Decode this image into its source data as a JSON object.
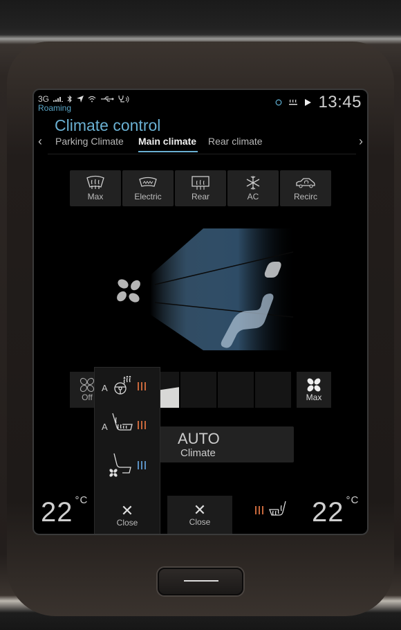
{
  "status_bar": {
    "network": "3G",
    "roaming": "Roaming",
    "left_icons": [
      "signal-icon",
      "bluetooth-icon",
      "location-icon",
      "wifi-icon",
      "usb-icon",
      "stethoscope-icon"
    ],
    "right_icons": [
      "sync-icon",
      "heat-icon",
      "play-icon"
    ],
    "clock": "13:45"
  },
  "header": {
    "title": "Climate control",
    "tabs": [
      {
        "label": "Parking Climate",
        "active": false
      },
      {
        "label": "Main climate",
        "active": true
      },
      {
        "label": "Rear climate",
        "active": false
      }
    ]
  },
  "climate_buttons": [
    {
      "label": "Max",
      "icon": "max-defrost-icon"
    },
    {
      "label": "Electric",
      "icon": "electric-windshield-icon"
    },
    {
      "label": "Rear",
      "icon": "rear-defrost-icon"
    },
    {
      "label": "AC",
      "icon": "ac-snowflake-icon"
    },
    {
      "label": "Recirc",
      "icon": "recirc-icon"
    }
  ],
  "fan": {
    "off_label": "Off",
    "max_label": "Max",
    "level_fraction": 0.4,
    "segments": 5
  },
  "auto": {
    "line1": "AUTO",
    "line2": "Climate"
  },
  "temperature": {
    "left": "22",
    "right": "22",
    "unit": "°C"
  },
  "seat_popup": {
    "items": [
      {
        "mode": "A",
        "icon": "heated-steering-wheel-icon",
        "level": 3,
        "color": "#c8683c"
      },
      {
        "mode": "A",
        "icon": "heated-seat-icon",
        "level": 3,
        "color": "#c8683c"
      },
      {
        "mode": "",
        "icon": "ventilated-seat-icon",
        "level": 3,
        "color": "#5a8fc0"
      }
    ],
    "close_label": "Close"
  },
  "close_button": {
    "label": "Close"
  },
  "right_seat_heat": {
    "level": 3,
    "color": "#c8683c"
  },
  "colors": {
    "accent": "#6ab0d2",
    "heat": "#c8683c",
    "cool": "#5a8fc0"
  }
}
